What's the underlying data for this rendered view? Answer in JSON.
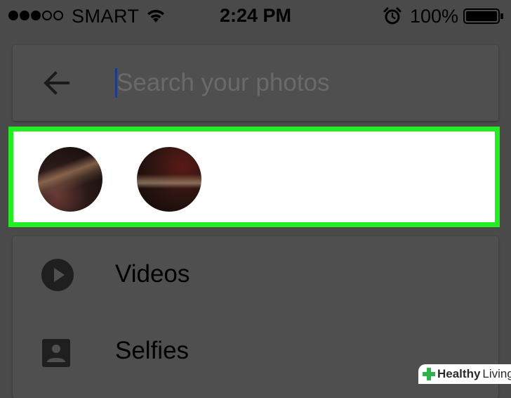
{
  "status_bar": {
    "signal_strength": 3,
    "signal_max": 5,
    "carrier": "SMART",
    "wifi_icon": "wifi-icon",
    "time": "2:24 PM",
    "alarm_icon": "alarm-clock-icon",
    "battery_percent": "100%",
    "battery_icon": "battery-full-icon"
  },
  "search": {
    "back_icon": "arrow-left-icon",
    "value": "",
    "placeholder": "Search your photos"
  },
  "faces": {
    "items": [
      {
        "name": "face-group-1"
      },
      {
        "name": "face-group-2"
      }
    ],
    "highlight_color": "#22ee22"
  },
  "categories": {
    "items": [
      {
        "label": "Videos",
        "icon": "play-circle-icon"
      },
      {
        "label": "Selfies",
        "icon": "portrait-icon"
      }
    ]
  },
  "watermark": {
    "brand_bold": "Healthy",
    "brand_light": "Living",
    "logo_icon": "green-cross-icon"
  },
  "colors": {
    "background": "#4a4a4a",
    "card": "#4f4f4f",
    "highlight": "#22ee22",
    "cursor": "#1e3a8a"
  }
}
